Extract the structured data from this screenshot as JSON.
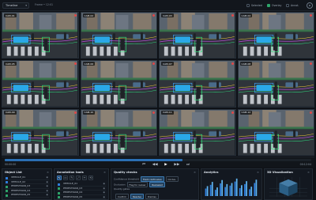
{
  "topbar": {
    "view_select": "Timeline",
    "info": "Frame • 12:01",
    "toggles": [
      {
        "label": "Selected",
        "on": false
      },
      {
        "label": "Overlay",
        "on": true
      },
      {
        "label": "Annot.",
        "on": false
      }
    ]
  },
  "cameras": [
    {
      "label": "CAM-01"
    },
    {
      "label": "CAM-02"
    },
    {
      "label": "CAM-03"
    },
    {
      "label": "CAM-04"
    },
    {
      "label": "CAM-05"
    },
    {
      "label": "CAM-06"
    },
    {
      "label": "CAM-07"
    },
    {
      "label": "CAM-08"
    },
    {
      "label": "CAM-09"
    },
    {
      "label": "CAM-10"
    },
    {
      "label": "CAM-11"
    },
    {
      "label": "CAM-12"
    }
  ],
  "timeline": {
    "progress": 0.58,
    "time_left": "00:00:00",
    "time_right": "00:12:04",
    "controls": {
      "start": "⏮",
      "back": "◀◀",
      "play": "▶",
      "fwd": "▶▶",
      "end": "⏭"
    }
  },
  "panels": {
    "objects": {
      "title": "Object List",
      "items": [
        {
          "label": "VEHICLE_01",
          "color": "#2f7fe0"
        },
        {
          "label": "VEHICLE_02",
          "color": "#2f7fe0"
        },
        {
          "label": "PEDESTRIAN_03",
          "color": "#2ea56a"
        },
        {
          "label": "PEDESTRIAN_04",
          "color": "#2ea56a"
        },
        {
          "label": "PEDESTRIAN_05",
          "color": "#2ea56a"
        }
      ]
    },
    "annotation": {
      "title": "Annotation tools",
      "tools": [
        "↖",
        "▭",
        "✎",
        "⤢",
        "✂",
        "⟲"
      ],
      "items": [
        {
          "label": "VEHICLE_01",
          "color": "#2f7fe0"
        },
        {
          "label": "PEDESTRIAN_03",
          "color": "#2ea56a"
        },
        {
          "label": "PEDESTRIAN_04",
          "color": "#2ea56a"
        },
        {
          "label": "PEDESTRIAN_05",
          "color": "#2ea56a"
        }
      ]
    },
    "quality": {
      "title": "Quality checks",
      "rows": [
        {
          "label": "Confidence threshold",
          "chips": [
            {
              "label": "Track continuous",
              "on": true
            },
            {
              "label": "Occlus.",
              "on": false
            }
          ]
        },
        {
          "label": "Occlusion",
          "chips": [
            {
              "label": "Flag for review",
              "on": false
            },
            {
              "label": "Reviewed",
              "on": true
            }
          ]
        },
        {
          "label": "Quality gates",
          "chips": []
        }
      ],
      "actions": [
        {
          "label": "Confirm",
          "on": false
        },
        {
          "label": "Resolve",
          "on": true
        },
        {
          "label": "Dismiss",
          "on": false
        }
      ]
    },
    "analytics": {
      "title": "Analytics",
      "bars": [
        {
          "a": 0.42,
          "b": 0.55
        },
        {
          "a": 0.62,
          "b": 0.78
        },
        {
          "a": 0.35,
          "b": 0.48
        },
        {
          "a": 0.7,
          "b": 0.88
        },
        {
          "a": 0.5,
          "b": 0.66
        },
        {
          "a": 0.58,
          "b": 0.72
        },
        {
          "a": 0.8,
          "b": 0.96
        },
        {
          "a": 0.44,
          "b": 0.6
        },
        {
          "a": 0.66,
          "b": 0.82
        },
        {
          "a": 0.38,
          "b": 0.52
        },
        {
          "a": 0.72,
          "b": 0.9
        }
      ],
      "color_a": "#2f7fe0",
      "color_b": "#5fb4f0"
    },
    "viz3d": {
      "title": "3D Visualization"
    }
  }
}
